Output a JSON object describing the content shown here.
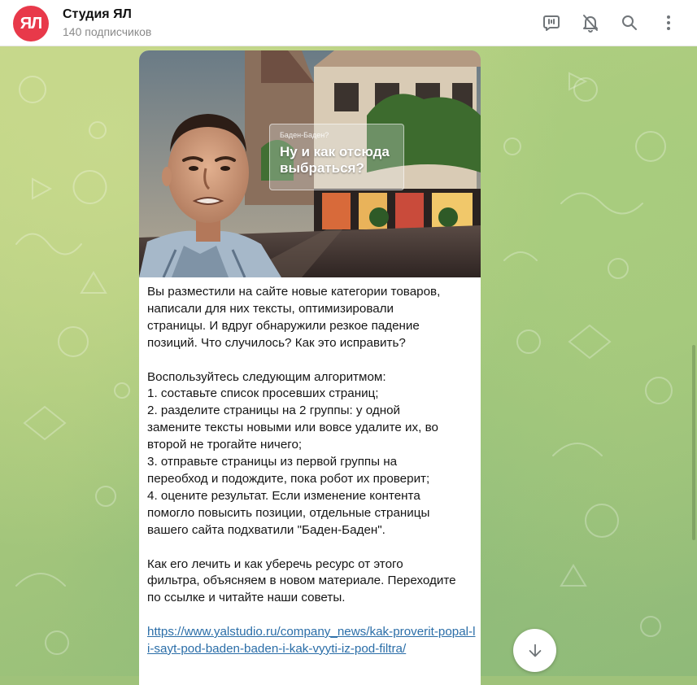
{
  "channel": {
    "title": "Студия ЯЛ",
    "subscribers": "140 подписчиков",
    "avatar_text": "ЯЛ",
    "avatar_color": "#e8394a"
  },
  "header_actions": [
    {
      "name": "live-stream-icon"
    },
    {
      "name": "bell-off-icon"
    },
    {
      "name": "search-icon"
    },
    {
      "name": "more-vertical-icon"
    }
  ],
  "message": {
    "image": {
      "small_label": "Баден-Баден?",
      "headline": "Ну и как отсюда выбраться?"
    },
    "text": "Вы разместили на сайте новые категории товаров,\nнаписали для них тексты, оптимизировали\nстраницы. И вдруг обнаружили резкое падение\nпозиций. Что случилось? Как это исправить?\n\nВоспользуйтесь следующим алгоритмом:\n1. составьте список просевших страниц;\n2. разделите страницы на 2 группы: у одной\nзамените тексты новыми или вовсе удалите их, во\nвторой не трогайте ничего;\n3. отправьте страницы из первой группы на\nпереобход и подождите, пока робот их проверит;\n4. оцените результат. Если изменение контента\nпомогло повысить позиции, отдельные страницы\nвашего сайта подхватили \"Баден-Баден\".\n\nКак его лечить и как уберечь ресурс от этого\nфильтра, объясняем в новом материале. Переходите\nпо ссылке и читайте наши советы.",
    "link": "https://www.yalstudio.ru/company_news/kak-proverit-popal-li-sayt-pod-baden-baden-i-kak-vyyti-iz-pod-filtra/"
  },
  "scroll_down": {
    "icon": "arrow-down-icon"
  }
}
